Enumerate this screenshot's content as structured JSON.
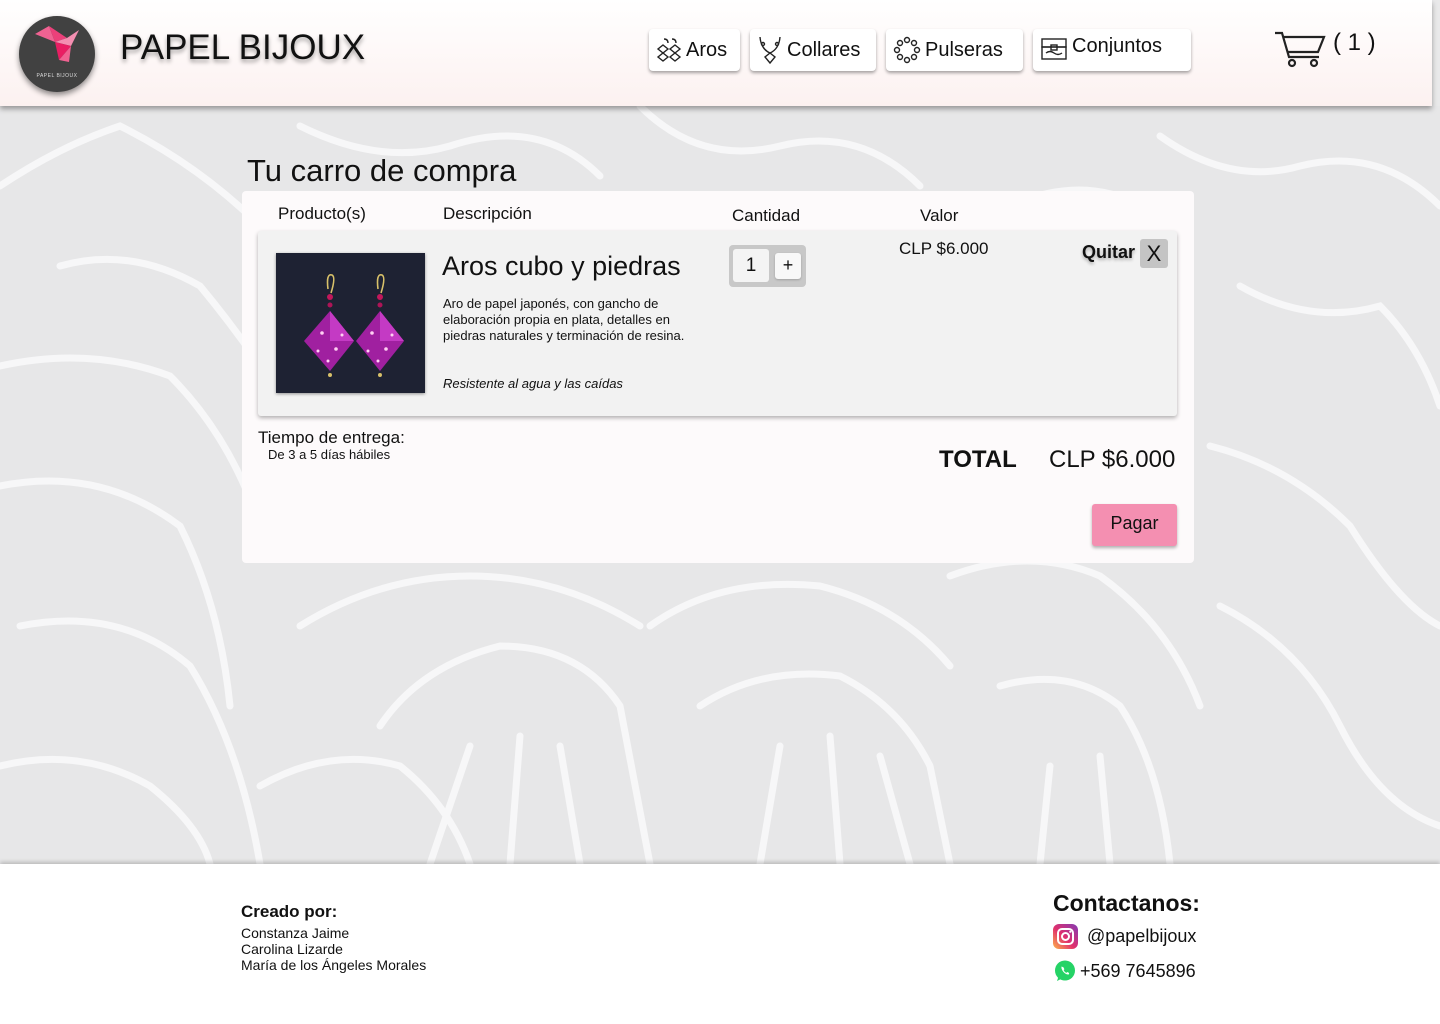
{
  "header": {
    "brand": "PAPEL BIJOUX",
    "logo_text": "PAPEL BIJOUX",
    "nav": [
      {
        "label": "Aros",
        "icon": "earrings-icon"
      },
      {
        "label": "Collares",
        "icon": "necklace-icon"
      },
      {
        "label": "Pulseras",
        "icon": "bracelet-icon"
      },
      {
        "label": "Conjuntos",
        "icon": "jewelry-box-icon"
      }
    ],
    "cart_count": "( 1 )"
  },
  "cart": {
    "title": "Tu carro de compra",
    "columns": {
      "product": "Producto(s)",
      "description": "Descripción",
      "quantity": "Cantidad",
      "value": "Valor"
    },
    "items": [
      {
        "name": "Aros cubo y piedras",
        "description": "Aro de papel japonés, con gancho de elaboración propia en plata, detalles en piedras naturales y terminación de resina.",
        "note": "Resistente al agua y las caídas",
        "quantity": "1",
        "plus_label": "+",
        "price": "CLP $6.000",
        "remove_label": "Quitar",
        "remove_icon": "X"
      }
    ],
    "delivery_label": "Tiempo de entrega:",
    "delivery_value": "De 3 a 5 días hábiles",
    "total_label": "TOTAL",
    "total_value": "CLP $6.000",
    "pay_label": "Pagar"
  },
  "footer": {
    "credits_title": "Creado por:",
    "credits": [
      "Constanza Jaime",
      "Carolina Lizarde",
      "María de los Ángeles Morales"
    ],
    "contact_title": "Contactanos:",
    "instagram": "@papelbijoux",
    "whatsapp": "+569 7645896"
  },
  "colors": {
    "accent": "#f48fb1",
    "header_bg": "#fcf1f0",
    "logo_bg": "#414141"
  }
}
